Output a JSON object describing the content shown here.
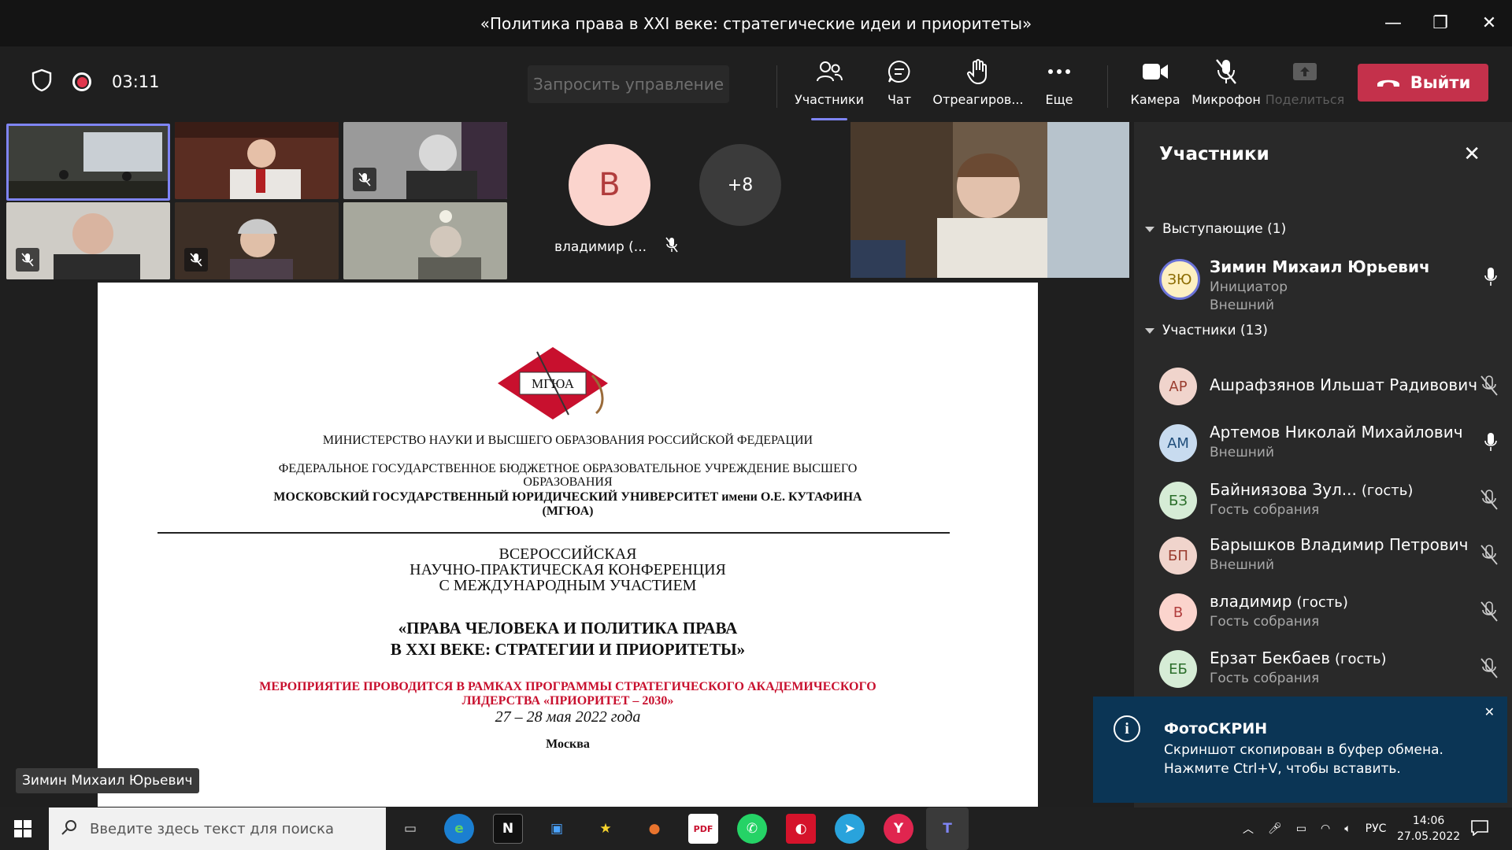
{
  "window": {
    "title": "«Политика права в XXI веке: стратегические идеи и приоритеты»",
    "minimize": "—",
    "maximize": "❐",
    "close": "✕"
  },
  "toolbar": {
    "timer": "03:11",
    "request_control": "Запросить управление",
    "participants": "Участники",
    "chat": "Чат",
    "react": "Отреагиров...",
    "more": "Еще",
    "camera": "Камера",
    "microphone": "Микрофон",
    "share": "Поделиться",
    "leave": "Выйти"
  },
  "stage": {
    "avatar_letter": "В",
    "avatar_name": "владимир (...",
    "overflow_count": "+8",
    "presenter_tag": "Зимин Михаил Юрьевич"
  },
  "slide": {
    "logo_text": "МГЮА",
    "line1": "МИНИСТЕРСТВО НАУКИ И ВЫСШЕГО ОБРАЗОВАНИЯ РОССИЙСКОЙ ФЕДЕРАЦИИ",
    "line2": "ФЕДЕРАЛЬНОЕ ГОСУДАРСТВЕННОЕ БЮДЖЕТНОЕ ОБРАЗОВАТЕЛЬНОЕ УЧРЕЖДЕНИЕ ВЫСШЕГО",
    "line3": "ОБРАЗОВАНИЯ",
    "line4": "МОСКОВСКИЙ ГОСУДАРСТВЕННЫЙ ЮРИДИЧЕСКИЙ УНИВЕРСИТЕТ имени О.Е. КУТАФИНА",
    "line5": "(МГЮА)",
    "conf1": "ВСЕРОССИЙСКАЯ",
    "conf2": "НАУЧНО-ПРАКТИЧЕСКАЯ КОНФЕРЕНЦИЯ",
    "conf3": "С МЕЖДУНАРОДНЫМ УЧАСТИЕМ",
    "title1": "«ПРАВА ЧЕЛОВЕКА И ПОЛИТИКА ПРАВА",
    "title2": "В XXI ВЕКЕ: СТРАТЕГИИ И ПРИОРИТЕТЫ»",
    "red1": "МЕРОПРИЯТИЕ ПРОВОДИТСЯ В РАМКАХ ПРОГРАММЫ СТРАТЕГИЧЕСКОГО АКАДЕМИЧЕСКОГО",
    "red2": "ЛИДЕРСТВА «ПРИОРИТЕТ – 2030»",
    "dates": "27 – 28 мая 2022 года",
    "city": "Москва"
  },
  "panel": {
    "title": "Участники",
    "presenters_header": "Выступающие (1)",
    "attendees_header": "Участники (13)",
    "presenter": {
      "initials": "ЗЮ",
      "name": "Зимин Михаил Юрьевич",
      "role": "Инициатор",
      "sub": "Внешний"
    },
    "people": [
      {
        "initials": "АР",
        "name": "Ашрафзянов Ильшат Радивович",
        "guest": "",
        "sub": ""
      },
      {
        "initials": "АМ",
        "name": "Артемов Николай Михайлович",
        "guest": "",
        "sub": "Внешний"
      },
      {
        "initials": "БЗ",
        "name": "Байниязова Зул...",
        "guest": "(гость)",
        "sub": "Гость собрания"
      },
      {
        "initials": "БП",
        "name": "Барышков Владимир Петрович",
        "guest": "",
        "sub": "Внешний"
      },
      {
        "initials": "В",
        "name": "владимир",
        "guest": "(гость)",
        "sub": "Гость собрания"
      },
      {
        "initials": "ЕБ",
        "name": "Ерзат Бекбаев",
        "guest": "(гость)",
        "sub": "Гость собрания"
      }
    ]
  },
  "toast": {
    "title": "ФотоСКРИН",
    "line1": "Скриншот скопирован в буфер обмена.",
    "line2": "Нажмите Ctrl+V, чтобы вставить."
  },
  "taskbar": {
    "search_placeholder": "Введите здесь текст для поиска",
    "lang": "РУС",
    "time": "14:06",
    "date": "27.05.2022"
  },
  "colors": {
    "accent": "#7f85f5",
    "leave": "#c4314b",
    "toast": "#0b3555",
    "slide_red": "#c8102e"
  }
}
